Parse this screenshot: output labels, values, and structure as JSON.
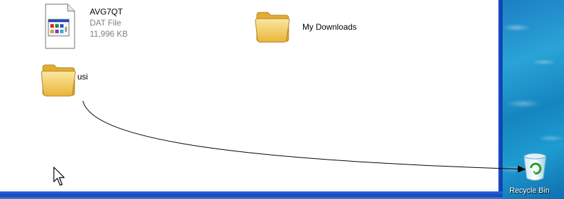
{
  "files": [
    {
      "name": "AVG7QT",
      "type": "DAT File",
      "size": "11,996 KB",
      "icon": "dat-file-icon"
    },
    {
      "name": "My Downloads",
      "icon": "folder-icon"
    },
    {
      "name": "usi",
      "icon": "folder-icon"
    }
  ],
  "desktop": {
    "recycle_bin": {
      "label": "Recycle Bin",
      "icon": "recycle-bin-icon"
    }
  },
  "annotation": {
    "type": "drag-path-arrow",
    "from": "usi",
    "to": "Recycle Bin"
  },
  "cursor": {
    "icon": "mouse-pointer-icon"
  },
  "colors": {
    "window_border": "#1546b8",
    "folder_yellow": "#f3c94e",
    "meta_text": "#808080"
  }
}
